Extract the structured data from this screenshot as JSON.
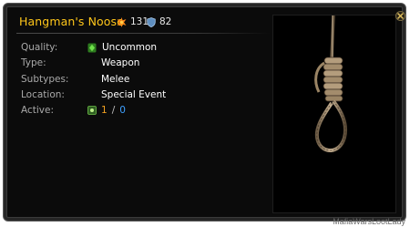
{
  "item": {
    "name": "Hangman's Noose",
    "attack": "131",
    "defense": "82"
  },
  "details": {
    "quality_label": "Quality:",
    "quality_value": "Uncommon",
    "type_label": "Type:",
    "type_value": "Weapon",
    "subtypes_label": "Subtypes:",
    "subtypes_value": "Melee",
    "location_label": "Location:",
    "location_value": "Special Event",
    "active_label": "Active:",
    "active_count": "1",
    "active_sep": "/",
    "active_total": "0"
  },
  "icons": {
    "attack": "attack-burst-icon",
    "defense": "shield-icon",
    "quality": "green-gem-icon",
    "active": "active-toggle-icon",
    "close": "close-icon",
    "image": "noose-image"
  },
  "colors": {
    "title": "#ffc61a",
    "quality_gem": "#43b52a",
    "active_count": "#f0a020",
    "active_total": "#3ea0ff"
  },
  "watermark": "MafiaWarsLootLady"
}
